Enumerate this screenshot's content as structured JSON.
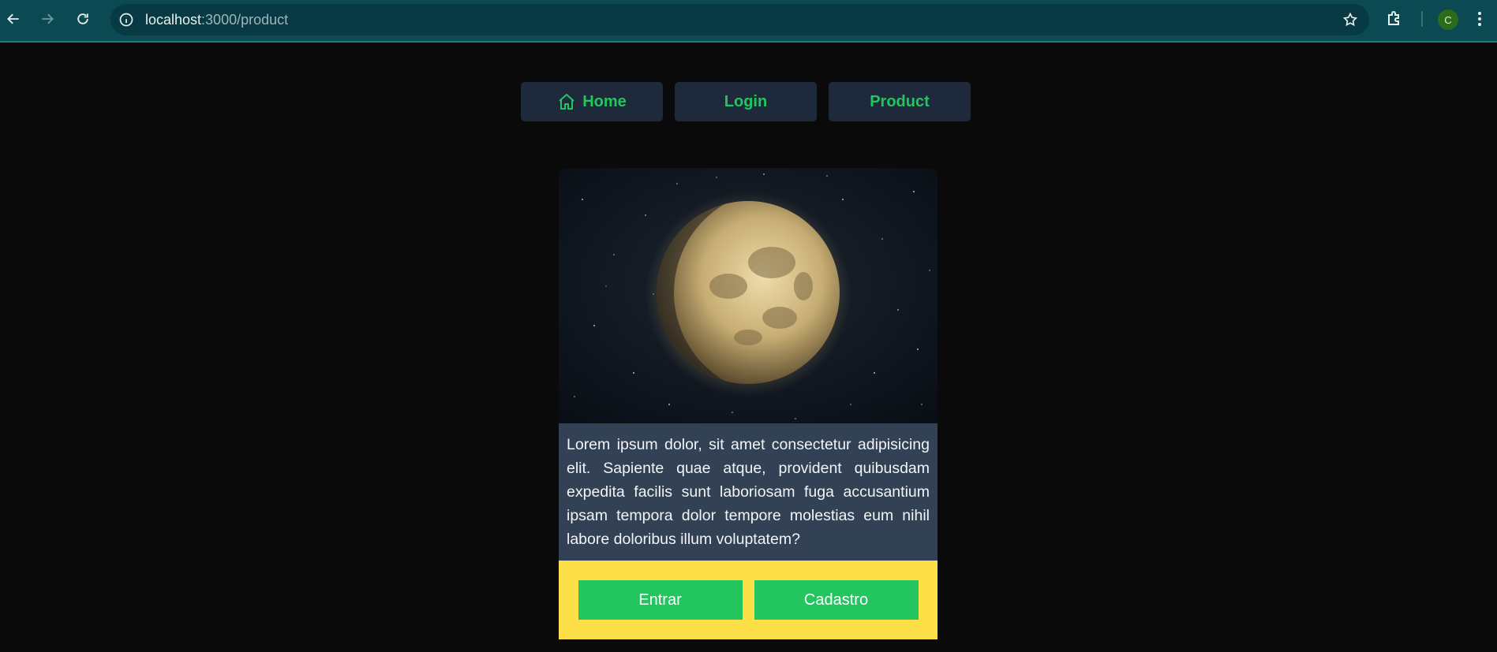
{
  "browser": {
    "url_host": "localhost",
    "url_rest": ":3000/product",
    "profile_initial": "C",
    "icons": [
      "back-icon",
      "forward-icon",
      "reload-icon",
      "info-icon",
      "star-icon",
      "extensions-icon",
      "menu-icon"
    ]
  },
  "nav": {
    "items": [
      {
        "label": "Home",
        "icon": "home-icon"
      },
      {
        "label": "Login"
      },
      {
        "label": "Product"
      }
    ]
  },
  "card": {
    "image": "moon-image",
    "description": "Lorem ipsum dolor, sit amet consectetur adipisicing elit. Sapiente quae atque, provident quibusdam expedita facilis sunt laboriosam fuga accusantium ipsam tempora dolor tempore molestias eum nihil labore doloribus illum voluptatem?",
    "actions": {
      "primary_label": "Entrar",
      "secondary_label": "Cadastro"
    }
  },
  "colors": {
    "page_bg": "#0a0a0a",
    "nav_bg": "#1e293b",
    "accent_green": "#22c55e",
    "card_text_bg": "#334155",
    "card_actions_bg": "#fde047",
    "chrome_bg": "#0b4a52"
  }
}
